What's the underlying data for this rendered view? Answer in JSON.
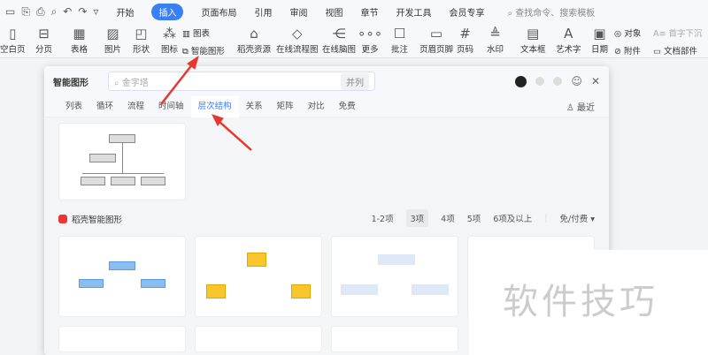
{
  "menubar": {
    "tabs": [
      "开始",
      "插入",
      "页面布局",
      "引用",
      "审阅",
      "视图",
      "章节",
      "开发工具",
      "会员专享"
    ],
    "active": "插入",
    "search": "查找命令、搜索模板"
  },
  "ribbon": {
    "buttons": [
      "空白页",
      "分页",
      "表格",
      "图片",
      "形状",
      "图标",
      "稻壳资源",
      "在线流程图",
      "在线脑图",
      "更多",
      "批注",
      "页眉页脚",
      "页码",
      "水印",
      "文本框",
      "艺术字",
      "日期"
    ],
    "small": [
      "图表",
      "智能图形",
      "对象",
      "附件",
      "首字下沉",
      "文档部件"
    ]
  },
  "dialog": {
    "title": "智能图形",
    "search_placeholder": "金字塔",
    "search_tag": "并列",
    "tabs": [
      "列表",
      "循环",
      "流程",
      "时间轴",
      "层次结构",
      "关系",
      "矩阵",
      "对比",
      "免费"
    ],
    "active_tab": "层次结构",
    "recent": "最近",
    "section": "稻壳智能图形",
    "filters": [
      "1-2项",
      "3项",
      "4项",
      "5项",
      "6项及以上"
    ],
    "active_filter": "3项",
    "price": "免/付费"
  },
  "watermark": "软件技巧",
  "colors": {
    "accent": "#3a7ff6",
    "arrow": "#e8372f"
  }
}
